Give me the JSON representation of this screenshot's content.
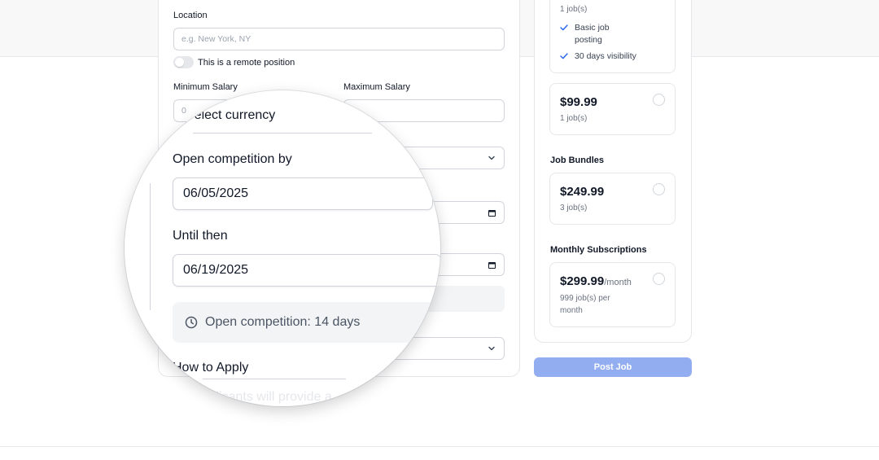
{
  "form": {
    "location_label": "Location",
    "location_placeholder": "e.g. New York, NY",
    "remote_label": "This is a remote position",
    "min_salary_label": "Minimum Salary",
    "max_salary_label": "Maximum Salary",
    "min_salary_value": "0"
  },
  "magnifier": {
    "currency_text": "Select currency",
    "open_by_label": "Open competition by",
    "open_by_value": "06/05/2025",
    "until_label": "Until then",
    "until_value": "06/19/2025",
    "competition_note": "Open competition: 14 days",
    "how_to_apply_label": "How to Apply",
    "applicants_text": "Applicants will provide a"
  },
  "pricing": {
    "top_card": {
      "jobs": "1 job(s)",
      "features": [
        "Basic job posting",
        "30 days visibility"
      ]
    },
    "single": {
      "price": "$99.99",
      "jobs": "1 job(s)"
    },
    "bundles_title": "Job Bundles",
    "bundle": {
      "price": "$249.99",
      "jobs": "3 job(s)"
    },
    "subscriptions_title": "Monthly Subscriptions",
    "subscription": {
      "price": "$299.99",
      "period": "/month",
      "jobs": "999 job(s) per month"
    },
    "post_button": "Post Job"
  },
  "colors": {
    "accent_disabled": "#93aef0",
    "check": "#2563eb"
  },
  "icons": [
    "check-icon",
    "chevron-down-icon",
    "calendar-icon",
    "clock-icon",
    "radio-icon"
  ]
}
